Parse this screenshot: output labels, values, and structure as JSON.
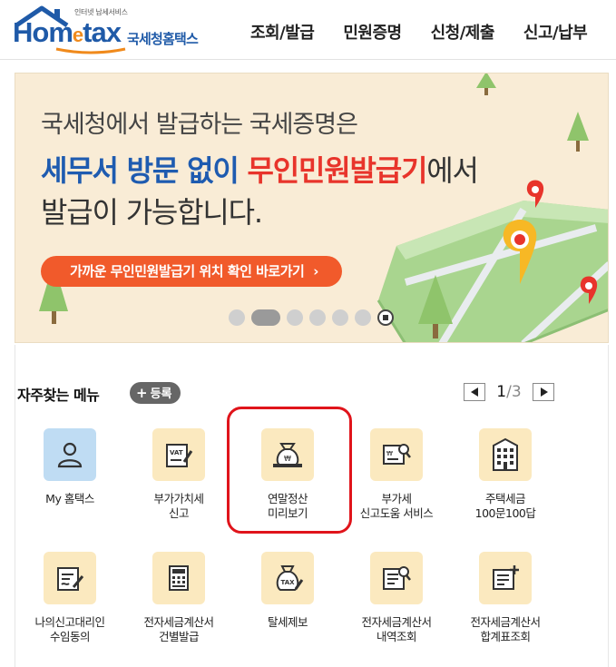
{
  "header": {
    "logo": {
      "tagline": "인터넷 납세서비스",
      "brand_home": "Hom",
      "brand_e": "e",
      "brand_tax": "tax",
      "brand_sub": "국세청홈택스"
    },
    "gnb": [
      "조회/발급",
      "민원증명",
      "신청/제출",
      "신고/납부"
    ]
  },
  "banner": {
    "line1": "국세청에서 발급하는 국세증명은",
    "line2_blue": "세무서 방문 없이",
    "line2_red": "무인민원발급기",
    "line2_end": "에서",
    "line3": "발급이 가능합니다.",
    "cta": "가까운 무인민원발급기 위치 확인 바로가기",
    "cta_arrow": "›",
    "slides_total": 6,
    "slide_active": 2
  },
  "quick_menu": {
    "title": "자주찾는 메뉴",
    "register_plus": "+",
    "register_label": "등록",
    "page_current": "1",
    "page_sep": "/",
    "page_total": "3",
    "items": [
      {
        "label": "My 홈택스",
        "icon": "user-icon"
      },
      {
        "label": "부가가치세\n신고",
        "icon": "vat-icon"
      },
      {
        "label": "연말정산\n미리보기",
        "icon": "money-bag-icon"
      },
      {
        "label": "부가세\n신고도움 서비스",
        "icon": "document-search-icon"
      },
      {
        "label": "주택세금\n100문100답",
        "icon": "building-icon"
      },
      {
        "label": "나의신고대리인\n수임동의",
        "icon": "document-sign-icon"
      },
      {
        "label": "전자세금계산서\n건별발급",
        "icon": "calculator-icon"
      },
      {
        "label": "탈세제보",
        "icon": "tax-bag-icon"
      },
      {
        "label": "전자세금계산서\n내역조회",
        "icon": "invoice-search-icon"
      },
      {
        "label": "전자세금계산서\n합계표조회",
        "icon": "invoice-sum-icon"
      }
    ]
  },
  "colors": {
    "brand_blue": "#1f5aa8",
    "accent_red": "#e8342b",
    "cta_orange": "#f15a2b",
    "tile_bg": "#fbe9bf",
    "tile_blue": "#bfdcf3",
    "highlight": "#e0141b"
  }
}
